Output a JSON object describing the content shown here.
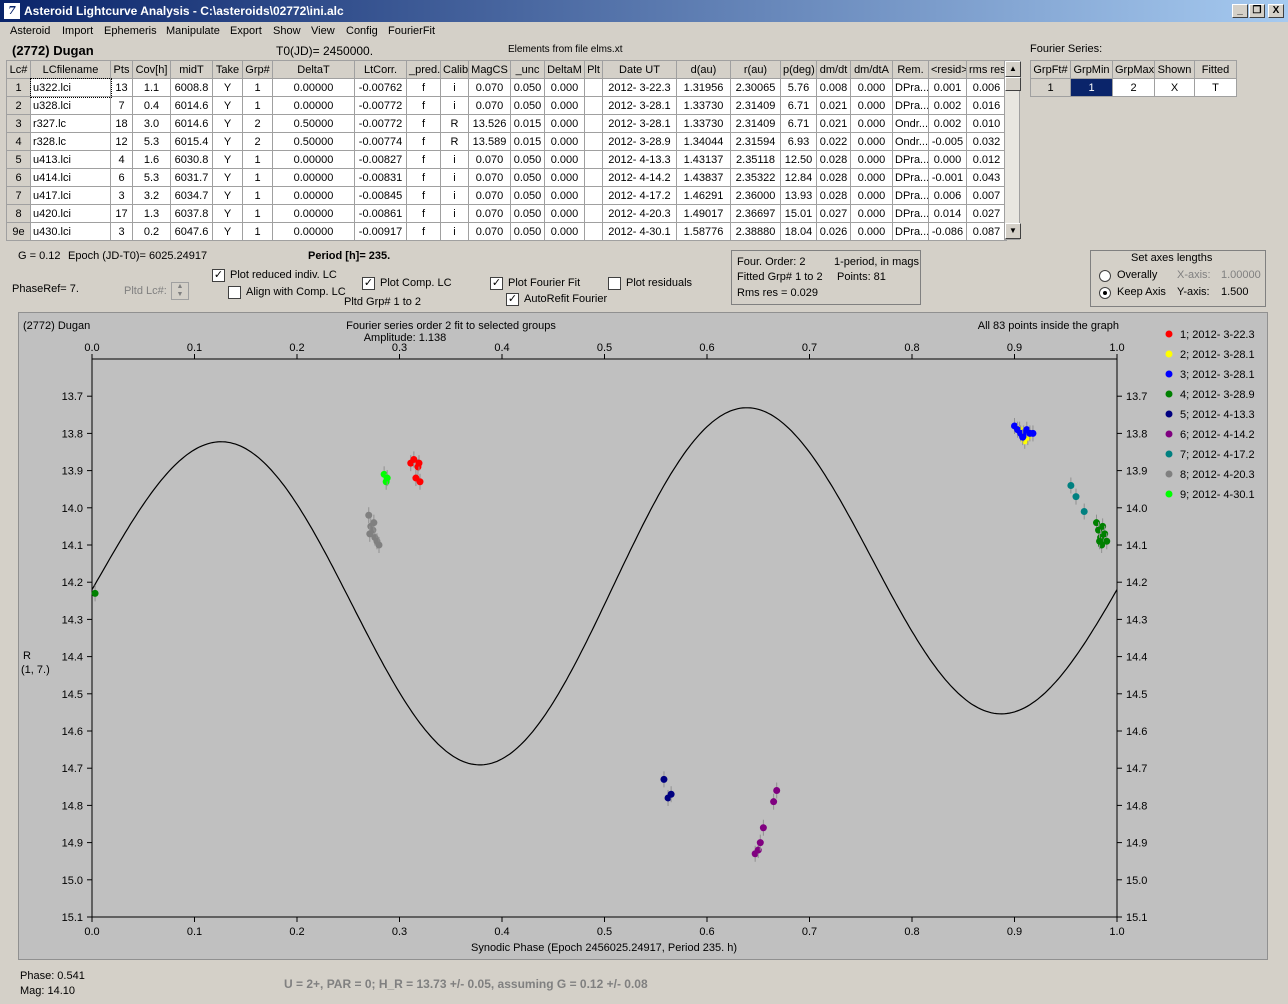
{
  "window": {
    "title": "Asteroid Lightcurve Analysis - C:\\asteroids\\02772\\ini.alc",
    "icon": "app-logo-icon",
    "controls": [
      "_",
      "❐",
      "X"
    ]
  },
  "menu": [
    "Asteroid",
    "Import",
    "Ephemeris",
    "Manipulate",
    "Export",
    "Show",
    "View",
    "Config",
    "FourierFit"
  ],
  "header": {
    "object": "(2772) Dugan",
    "t0": "T0(JD)= 2450000.",
    "elements": "Elements from file elms.xt"
  },
  "lc_table": {
    "columns": [
      "Lc#",
      "LCfilename",
      "Pts",
      "Cov[h]",
      "midT",
      "Take",
      "Grp#",
      "DeltaT",
      "LtCorr.",
      "_pred.",
      "Calib.",
      "MagCS",
      "_unc",
      "DeltaM",
      "Plt",
      "Date UT",
      "d(au)",
      "r(au)",
      "p(deg)",
      "dm/dt",
      "dm/dtA",
      "Rem.",
      "<resid>",
      "rms res"
    ],
    "rows": [
      [
        "1",
        "u322.lci",
        "13",
        "1.1",
        "6008.8",
        "Y",
        "1",
        "0.00000",
        "-0.00762",
        "f",
        "i",
        "0.070",
        "0.050",
        "0.000",
        "",
        "2012- 3-22.3",
        "1.31956",
        "2.30065",
        "5.76",
        "0.008",
        "0.000",
        "DPra...",
        "0.001",
        "0.006"
      ],
      [
        "2",
        "u328.lci",
        "7",
        "0.4",
        "6014.6",
        "Y",
        "1",
        "0.00000",
        "-0.00772",
        "f",
        "i",
        "0.070",
        "0.050",
        "0.000",
        "",
        "2012- 3-28.1",
        "1.33730",
        "2.31409",
        "6.71",
        "0.021",
        "0.000",
        "DPra...",
        "0.002",
        "0.016"
      ],
      [
        "3",
        "r327.lc",
        "18",
        "3.0",
        "6014.6",
        "Y",
        "2",
        "0.50000",
        "-0.00772",
        "f",
        "R",
        "13.526",
        "0.015",
        "0.000",
        "",
        "2012- 3-28.1",
        "1.33730",
        "2.31409",
        "6.71",
        "0.021",
        "0.000",
        "Ondr...",
        "0.002",
        "0.010"
      ],
      [
        "4",
        "r328.lc",
        "12",
        "5.3",
        "6015.4",
        "Y",
        "2",
        "0.50000",
        "-0.00774",
        "f",
        "R",
        "13.589",
        "0.015",
        "0.000",
        "",
        "2012- 3-28.9",
        "1.34044",
        "2.31594",
        "6.93",
        "0.022",
        "0.000",
        "Ondr...",
        "-0.005",
        "0.032"
      ],
      [
        "5",
        "u413.lci",
        "4",
        "1.6",
        "6030.8",
        "Y",
        "1",
        "0.00000",
        "-0.00827",
        "f",
        "i",
        "0.070",
        "0.050",
        "0.000",
        "",
        "2012- 4-13.3",
        "1.43137",
        "2.35118",
        "12.50",
        "0.028",
        "0.000",
        "DPra...",
        "0.000",
        "0.012"
      ],
      [
        "6",
        "u414.lci",
        "6",
        "5.3",
        "6031.7",
        "Y",
        "1",
        "0.00000",
        "-0.00831",
        "f",
        "i",
        "0.070",
        "0.050",
        "0.000",
        "",
        "2012- 4-14.2",
        "1.43837",
        "2.35322",
        "12.84",
        "0.028",
        "0.000",
        "DPra...",
        "-0.001",
        "0.043"
      ],
      [
        "7",
        "u417.lci",
        "3",
        "3.2",
        "6034.7",
        "Y",
        "1",
        "0.00000",
        "-0.00845",
        "f",
        "i",
        "0.070",
        "0.050",
        "0.000",
        "",
        "2012- 4-17.2",
        "1.46291",
        "2.36000",
        "13.93",
        "0.028",
        "0.000",
        "DPra...",
        "0.006",
        "0.007"
      ],
      [
        "8",
        "u420.lci",
        "17",
        "1.3",
        "6037.8",
        "Y",
        "1",
        "0.00000",
        "-0.00861",
        "f",
        "i",
        "0.070",
        "0.050",
        "0.000",
        "",
        "2012- 4-20.3",
        "1.49017",
        "2.36697",
        "15.01",
        "0.027",
        "0.000",
        "DPra...",
        "0.014",
        "0.027"
      ],
      [
        "9e",
        "u430.lci",
        "3",
        "0.2",
        "6047.6",
        "Y",
        "1",
        "0.00000",
        "-0.00917",
        "f",
        "i",
        "0.070",
        "0.050",
        "0.000",
        "",
        "2012- 4-30.1",
        "1.58776",
        "2.38880",
        "18.04",
        "0.026",
        "0.000",
        "DPra...",
        "-0.086",
        "0.087"
      ]
    ]
  },
  "fourier_series": {
    "label": "Fourier Series:",
    "columns": [
      "GrpFt#",
      "GrpMin",
      "GrpMax",
      "Shown",
      "Fitted"
    ],
    "row": [
      "1",
      "1",
      "2",
      "X",
      "T"
    ]
  },
  "params": {
    "g": "G = 0.12",
    "epoch": "Epoch (JD-T0)= 6025.24917",
    "period": "Period [h]= 235.",
    "phaseref": "PhaseRef= 7.",
    "pltd_lc": "Pltd Lc#:",
    "pltd_grp": "Pltd Grp#  1   to   2"
  },
  "checkboxes": {
    "plot_reduced": {
      "label": "Plot reduced indiv. LC",
      "checked": true
    },
    "align_comp": {
      "label": "Align with Comp. LC",
      "checked": false
    },
    "plot_comp": {
      "label": "Plot Comp. LC",
      "checked": true
    },
    "plot_fourier": {
      "label": "Plot Fourier Fit",
      "checked": true
    },
    "autorefit": {
      "label": "AutoRefit Fourier",
      "checked": true
    },
    "plot_residuals": {
      "label": "Plot residuals",
      "checked": false
    }
  },
  "fit_info": {
    "order": "Four. Order:  2",
    "period_note": "1-period, in mags",
    "fitted": "Fitted Grp# 1 to 2",
    "points": "Points: 81",
    "rms": "Rms res     = 0.029"
  },
  "axes_box": {
    "title": "Set axes lengths",
    "overally": "Overally",
    "keep_axis": "Keep Axis",
    "x_axis_label": "X-axis:",
    "x_axis_value": "1.00000",
    "y_axis_label": "Y-axis:",
    "y_axis_value": "1.500"
  },
  "footer": {
    "phase": "Phase:  0.541",
    "mag": "Mag:    14.10",
    "result": "U = 2+, PAR = 0; H_R = 13.73 +/- 0.05, assuming G = 0.12 +/- 0.08"
  },
  "chart_data": {
    "type": "scatter",
    "object_label": "(2772) Dugan",
    "title": "Fourier series order 2 fit to selected groups",
    "subtitle": "Amplitude: 1.138",
    "inside_note": "All 83 points inside the graph",
    "xlabel": "Synodic Phase (Epoch 2456025.24917, Period 235. h)",
    "ylabel": "R",
    "ylabel2": "(1, 7.)",
    "xlim": [
      0,
      1
    ],
    "ylim": [
      13.6,
      15.1
    ],
    "y_inverted": true,
    "xticks": [
      "0.0",
      "0.1",
      "0.2",
      "0.3",
      "0.4",
      "0.5",
      "0.6",
      "0.7",
      "0.8",
      "0.9",
      "1.0"
    ],
    "yticks": [
      "13.7",
      "13.8",
      "13.9",
      "14.0",
      "14.1",
      "14.2",
      "14.3",
      "14.4",
      "14.5",
      "14.6",
      "14.7",
      "14.8",
      "14.9",
      "15.0",
      "15.1"
    ],
    "legend_position": "right",
    "fit_curve": {
      "mean": 14.2,
      "a1": -0.02,
      "b1": 0.08,
      "a2": 0.04,
      "b2": -0.42
    },
    "series": [
      {
        "name": "1; 2012- 3-22.3",
        "color": "#ff0000",
        "points": [
          [
            0.311,
            13.88
          ],
          [
            0.314,
            13.87
          ],
          [
            0.318,
            13.89
          ],
          [
            0.32,
            13.93
          ],
          [
            0.316,
            13.92
          ],
          [
            0.319,
            13.88
          ]
        ]
      },
      {
        "name": "2; 2012- 3-28.1",
        "color": "#ffff00",
        "points": [
          [
            0.905,
            13.79
          ],
          [
            0.91,
            13.82
          ],
          [
            0.913,
            13.81
          ]
        ]
      },
      {
        "name": "3; 2012- 3-28.1",
        "color": "#0000ff",
        "points": [
          [
            0.9,
            13.78
          ],
          [
            0.903,
            13.79
          ],
          [
            0.906,
            13.8
          ],
          [
            0.909,
            13.8
          ],
          [
            0.912,
            13.79
          ],
          [
            0.915,
            13.8
          ],
          [
            0.918,
            13.8
          ],
          [
            0.908,
            13.81
          ]
        ]
      },
      {
        "name": "4; 2012- 3-28.9",
        "color": "#008000",
        "points": [
          [
            0.003,
            14.23
          ],
          [
            0.98,
            14.04
          ],
          [
            0.982,
            14.06
          ],
          [
            0.984,
            14.08
          ],
          [
            0.986,
            14.05
          ],
          [
            0.988,
            14.07
          ],
          [
            0.99,
            14.09
          ],
          [
            0.985,
            14.1
          ],
          [
            0.983,
            14.09
          ]
        ]
      },
      {
        "name": "5; 2012- 4-13.3",
        "color": "#000080",
        "points": [
          [
            0.558,
            14.73
          ],
          [
            0.562,
            14.78
          ],
          [
            0.565,
            14.77
          ]
        ]
      },
      {
        "name": "6; 2012- 4-14.2",
        "color": "#800080",
        "points": [
          [
            0.647,
            14.93
          ],
          [
            0.65,
            14.92
          ],
          [
            0.652,
            14.9
          ],
          [
            0.655,
            14.86
          ],
          [
            0.665,
            14.79
          ],
          [
            0.668,
            14.76
          ]
        ]
      },
      {
        "name": "7; 2012- 4-17.2",
        "color": "#008080",
        "points": [
          [
            0.955,
            13.94
          ],
          [
            0.96,
            13.97
          ],
          [
            0.968,
            14.01
          ]
        ]
      },
      {
        "name": "8; 2012- 4-20.3",
        "color": "#808080",
        "points": [
          [
            0.27,
            14.02
          ],
          [
            0.272,
            14.05
          ],
          [
            0.274,
            14.06
          ],
          [
            0.276,
            14.08
          ],
          [
            0.278,
            14.09
          ],
          [
            0.28,
            14.1
          ],
          [
            0.275,
            14.04
          ],
          [
            0.271,
            14.07
          ]
        ]
      },
      {
        "name": "9; 2012- 4-30.1",
        "color": "#00ff00",
        "points": [
          [
            0.285,
            13.91
          ],
          [
            0.287,
            13.93
          ],
          [
            0.288,
            13.92
          ]
        ]
      }
    ]
  }
}
